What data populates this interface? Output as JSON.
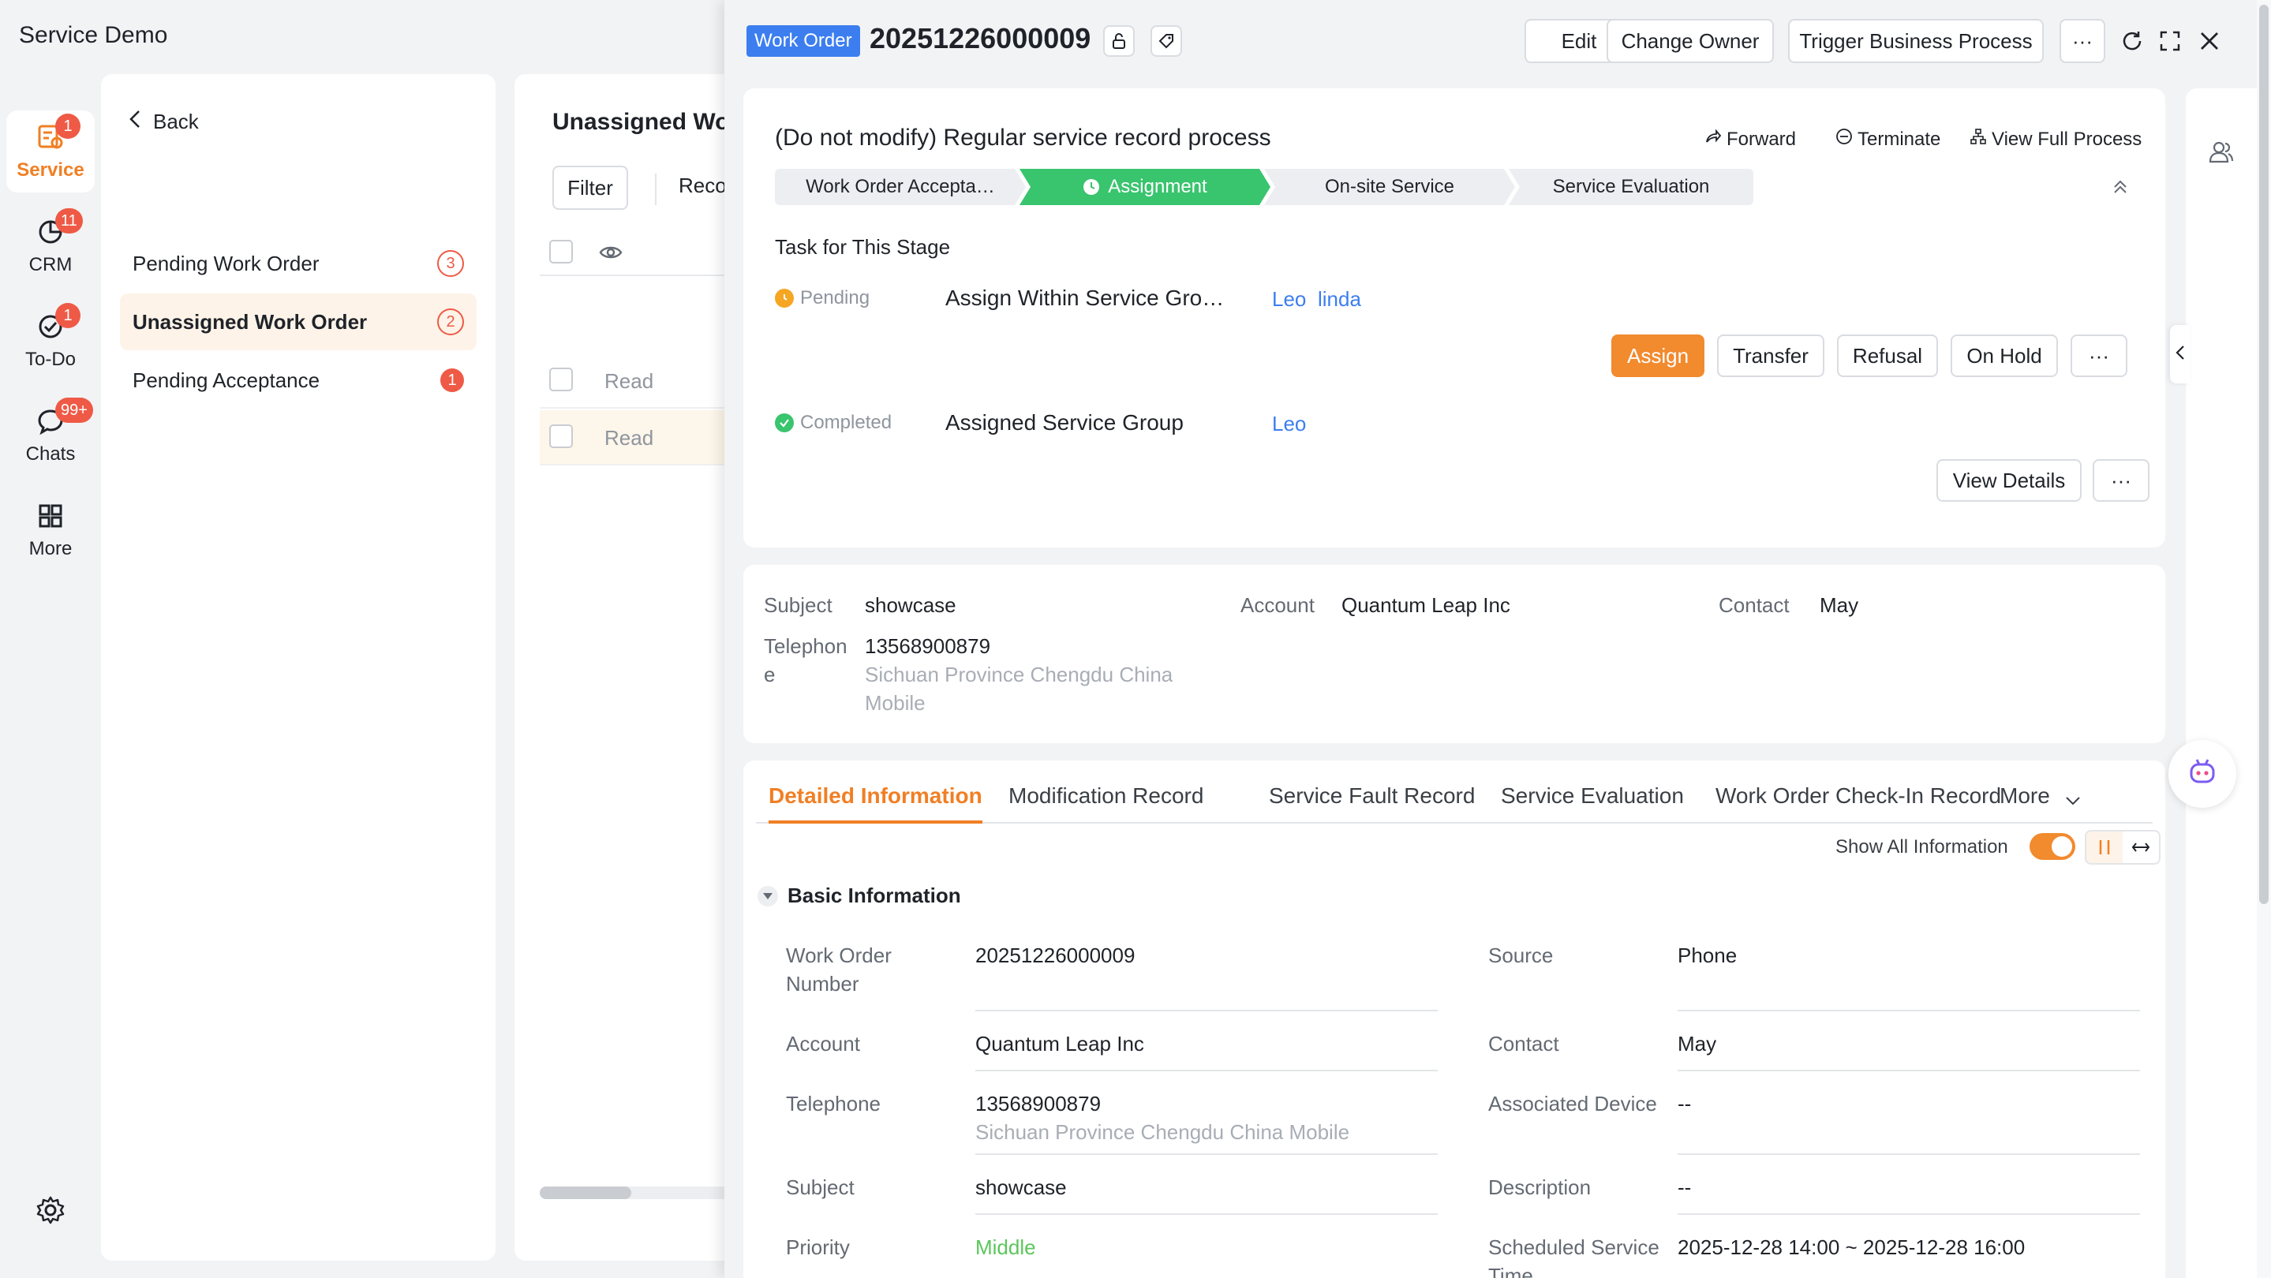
{
  "app": {
    "title": "Service Demo"
  },
  "rail": {
    "items": [
      {
        "label": "Service",
        "badge": "1",
        "icon": "service-icon"
      },
      {
        "label": "CRM",
        "badge": "11",
        "icon": "crm-icon"
      },
      {
        "label": "To-Do",
        "badge": "1",
        "icon": "todo-icon"
      },
      {
        "label": "Chats",
        "badge": "99+",
        "icon": "chat-icon"
      },
      {
        "label": "More",
        "badge": null,
        "icon": "grid-icon"
      }
    ]
  },
  "nav": {
    "back_label": "Back",
    "items": [
      {
        "label": "Pending Work Order",
        "count": "3"
      },
      {
        "label": "Unassigned Work Order",
        "count": "2"
      },
      {
        "label": "Pending Acceptance",
        "count": "1"
      }
    ]
  },
  "list": {
    "title": "Unassigned Wo",
    "filter_label": "Filter",
    "reco_label": "Reco",
    "rows": [
      {
        "status": "Read"
      },
      {
        "status": "Read"
      }
    ]
  },
  "drawer": {
    "tag": "Work Order",
    "number": "20251226000009",
    "buttons": {
      "edit": "Edit",
      "change_owner": "Change Owner",
      "trigger": "Trigger Business Process",
      "more": "···"
    },
    "process": {
      "title": "(Do not modify) Regular service record process",
      "forward": "Forward",
      "terminate": "Terminate",
      "view_full": "View Full Process",
      "stages": [
        "Work Order Accepta…",
        "Assignment",
        "On-site Service",
        "Service Evaluation"
      ],
      "task_title": "Task for This Stage",
      "tasks": [
        {
          "status": "Pending",
          "name": "Assign Within Service Gro…",
          "people": [
            "Leo",
            "linda"
          ]
        },
        {
          "status": "Completed",
          "name": "Assigned Service Group",
          "people": [
            "Leo"
          ]
        }
      ],
      "actions": {
        "assign": "Assign",
        "transfer": "Transfer",
        "refusal": "Refusal",
        "on_hold": "On Hold",
        "more": "···",
        "view_details": "View Details"
      }
    },
    "summary": {
      "subject_label": "Subject",
      "subject": "showcase",
      "account_label": "Account",
      "account": "Quantum Leap Inc",
      "contact_label": "Contact",
      "contact": "May",
      "telephone_label_1": "Telephon",
      "telephone_label_2": "e",
      "telephone": "13568900879",
      "telephone_loc_1": "Sichuan Province Chengdu China",
      "telephone_loc_2": "Mobile"
    },
    "tabs": [
      "Detailed Information",
      "Modification Record",
      "Service Fault Record",
      "Service Evaluation",
      "Work Order Check-In Record",
      "More"
    ],
    "show_all": "Show All Information",
    "section": "Basic Information",
    "fields": {
      "wo_number_label_1": "Work Order",
      "wo_number_label_2": "Number",
      "wo_number": "20251226000009",
      "source_label": "Source",
      "source": "Phone",
      "account_label": "Account",
      "account": "Quantum Leap Inc",
      "contact_label": "Contact",
      "contact": "May",
      "telephone_label": "Telephone",
      "telephone": "13568900879",
      "telephone_loc": "Sichuan Province Chengdu China Mobile",
      "device_label": "Associated Device",
      "device": "--",
      "subject_label": "Subject",
      "subject": "showcase",
      "description_label": "Description",
      "description": "--",
      "priority_label": "Priority",
      "priority": "Middle",
      "scheduled_label_1": "Scheduled Service",
      "scheduled_label_2": "Time",
      "scheduled": "2025-12-28 14:00 ~ 2025-12-28 16:00"
    }
  },
  "colors": {
    "accent": "#f07f24",
    "link": "#3c7ef0",
    "success": "#39c46e",
    "badge": "#ee5a46",
    "priority": "#5cc65c"
  }
}
